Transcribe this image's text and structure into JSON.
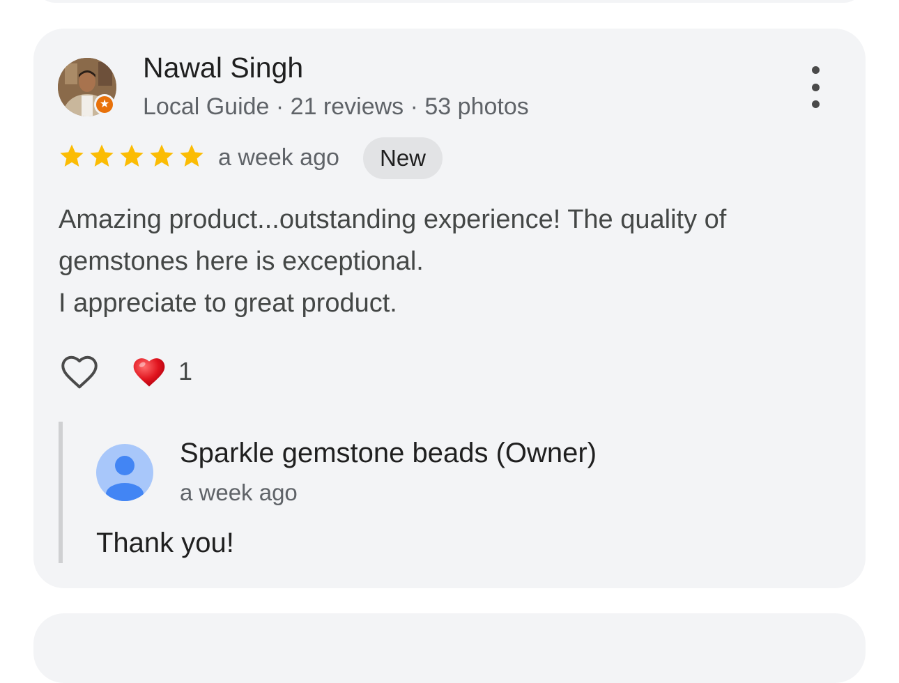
{
  "review": {
    "reviewer_name": "Nawal Singh",
    "reviewer_meta": "Local Guide · 21 reviews · 53 photos",
    "rating_stars": 5,
    "time": "a week ago",
    "badge": "New",
    "text_lines": [
      "Amazing product...outstanding experience! The quality of",
      "gemstones here is exceptional.",
      "I appreciate to great product."
    ],
    "reaction_count": "1",
    "icons": {
      "more": "more-vert-icon",
      "like": "heart-outline-icon",
      "reaction": "red-heart-emoji",
      "guide_badge": "local-guide-star-icon"
    }
  },
  "reply": {
    "owner_name": "Sparkle gemstone beads (Owner)",
    "time": "a week ago",
    "text": "Thank you!"
  },
  "colors": {
    "card_bg": "#f3f4f6",
    "star": "#fbbc04",
    "guide_badge": "#e8710a",
    "owner_avatar_bg": "#a8c7fa",
    "owner_avatar_fg": "#4285f4"
  }
}
